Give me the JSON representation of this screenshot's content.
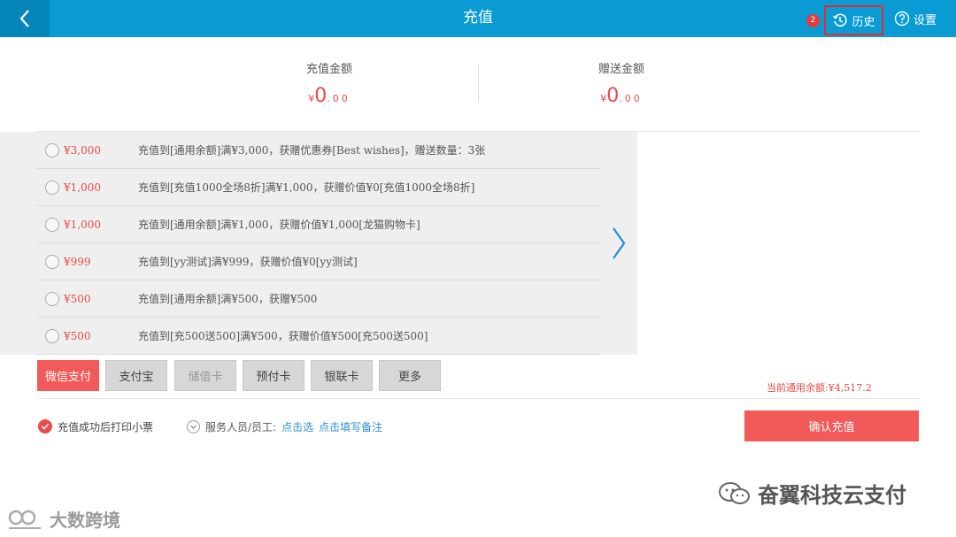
{
  "header": {
    "title": "充值",
    "badge_count": "2",
    "history_label": "历史",
    "settings_label": "设置",
    "bar_color": "#0a9bd4"
  },
  "summary": {
    "recharge_label": "充值金额",
    "recharge_symbol": "¥",
    "recharge_int": "0",
    "recharge_dec": ".00",
    "gift_label": "赠送金额",
    "gift_symbol": "¥",
    "gift_int": "0",
    "gift_dec": ".00"
  },
  "options": [
    {
      "price": "¥3,000",
      "desc": "充值到[通用余额]满¥3,000，获赠优惠券[Best wishes]，赠送数量：3张"
    },
    {
      "price": "¥1,000",
      "desc": "充值到[充值1000全场8折]满¥1,000，获赠价值¥0[充值1000全场8折]"
    },
    {
      "price": "¥1,000",
      "desc": "充值到[通用余额]满¥1,000，获赠价值¥1,000[龙猫购物卡]"
    },
    {
      "price": "¥999",
      "desc": "充值到[yy测试]满¥999，获赠价值¥0[yy测试]"
    },
    {
      "price": "¥500",
      "desc": "充值到[通用余额]满¥500，获赠¥500"
    },
    {
      "price": "¥500",
      "desc": "充值到[充500送500]满¥500，获赠价值¥500[充500送500]"
    }
  ],
  "payment": {
    "methods": [
      "微信支付",
      "支付宝",
      "储值卡",
      "预付卡",
      "银联卡",
      "更多"
    ],
    "selected": "微信支付",
    "accent_color": "#f25a5a"
  },
  "balance_text": "当前通用余额:¥4,517.2",
  "footer": {
    "print_label": "充值成功后打印小票",
    "staff_label": "服务人员/员工:",
    "staff_link": "点击选",
    "note_link": "点击填写备注",
    "confirm_label": "确认充值"
  },
  "watermarks": {
    "right": "奋翼科技云支付",
    "left": "大数跨境"
  }
}
